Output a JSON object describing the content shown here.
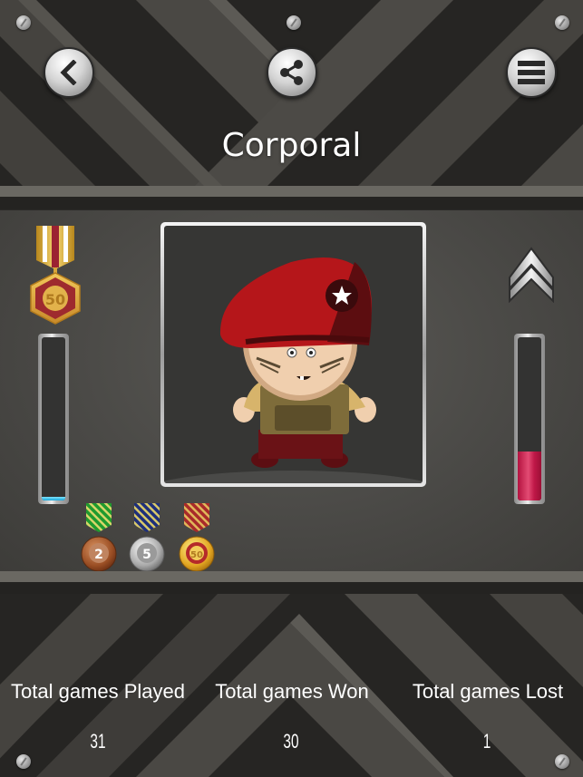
{
  "header": {
    "title": "Corporal",
    "back_icon": "chevron-left-icon",
    "share_icon": "share-icon",
    "menu_icon": "hamburger-menu-icon"
  },
  "rank": {
    "name": "Corporal",
    "insignia_icon": "corporal-chevron-icon",
    "progress_percent": 30,
    "progress_color": "#c8164a"
  },
  "medals": {
    "top_medal": {
      "label": "50",
      "type": "hexagon-gold-red"
    },
    "progress_percent": 2,
    "progress_color": "#1aa7d9",
    "earned": [
      {
        "label": "2",
        "type": "bronze",
        "ribbon": "green-striped"
      },
      {
        "label": "5",
        "type": "silver",
        "ribbon": "blue-striped"
      },
      {
        "label": "50",
        "type": "gold",
        "ribbon": "red-striped"
      }
    ]
  },
  "avatar": {
    "description": "soldier-with-red-beret"
  },
  "stats": [
    {
      "label": "Total games Played",
      "value": "31"
    },
    {
      "label": "Total games Won",
      "value": "30"
    },
    {
      "label": "Total games Lost",
      "value": "1"
    }
  ]
}
